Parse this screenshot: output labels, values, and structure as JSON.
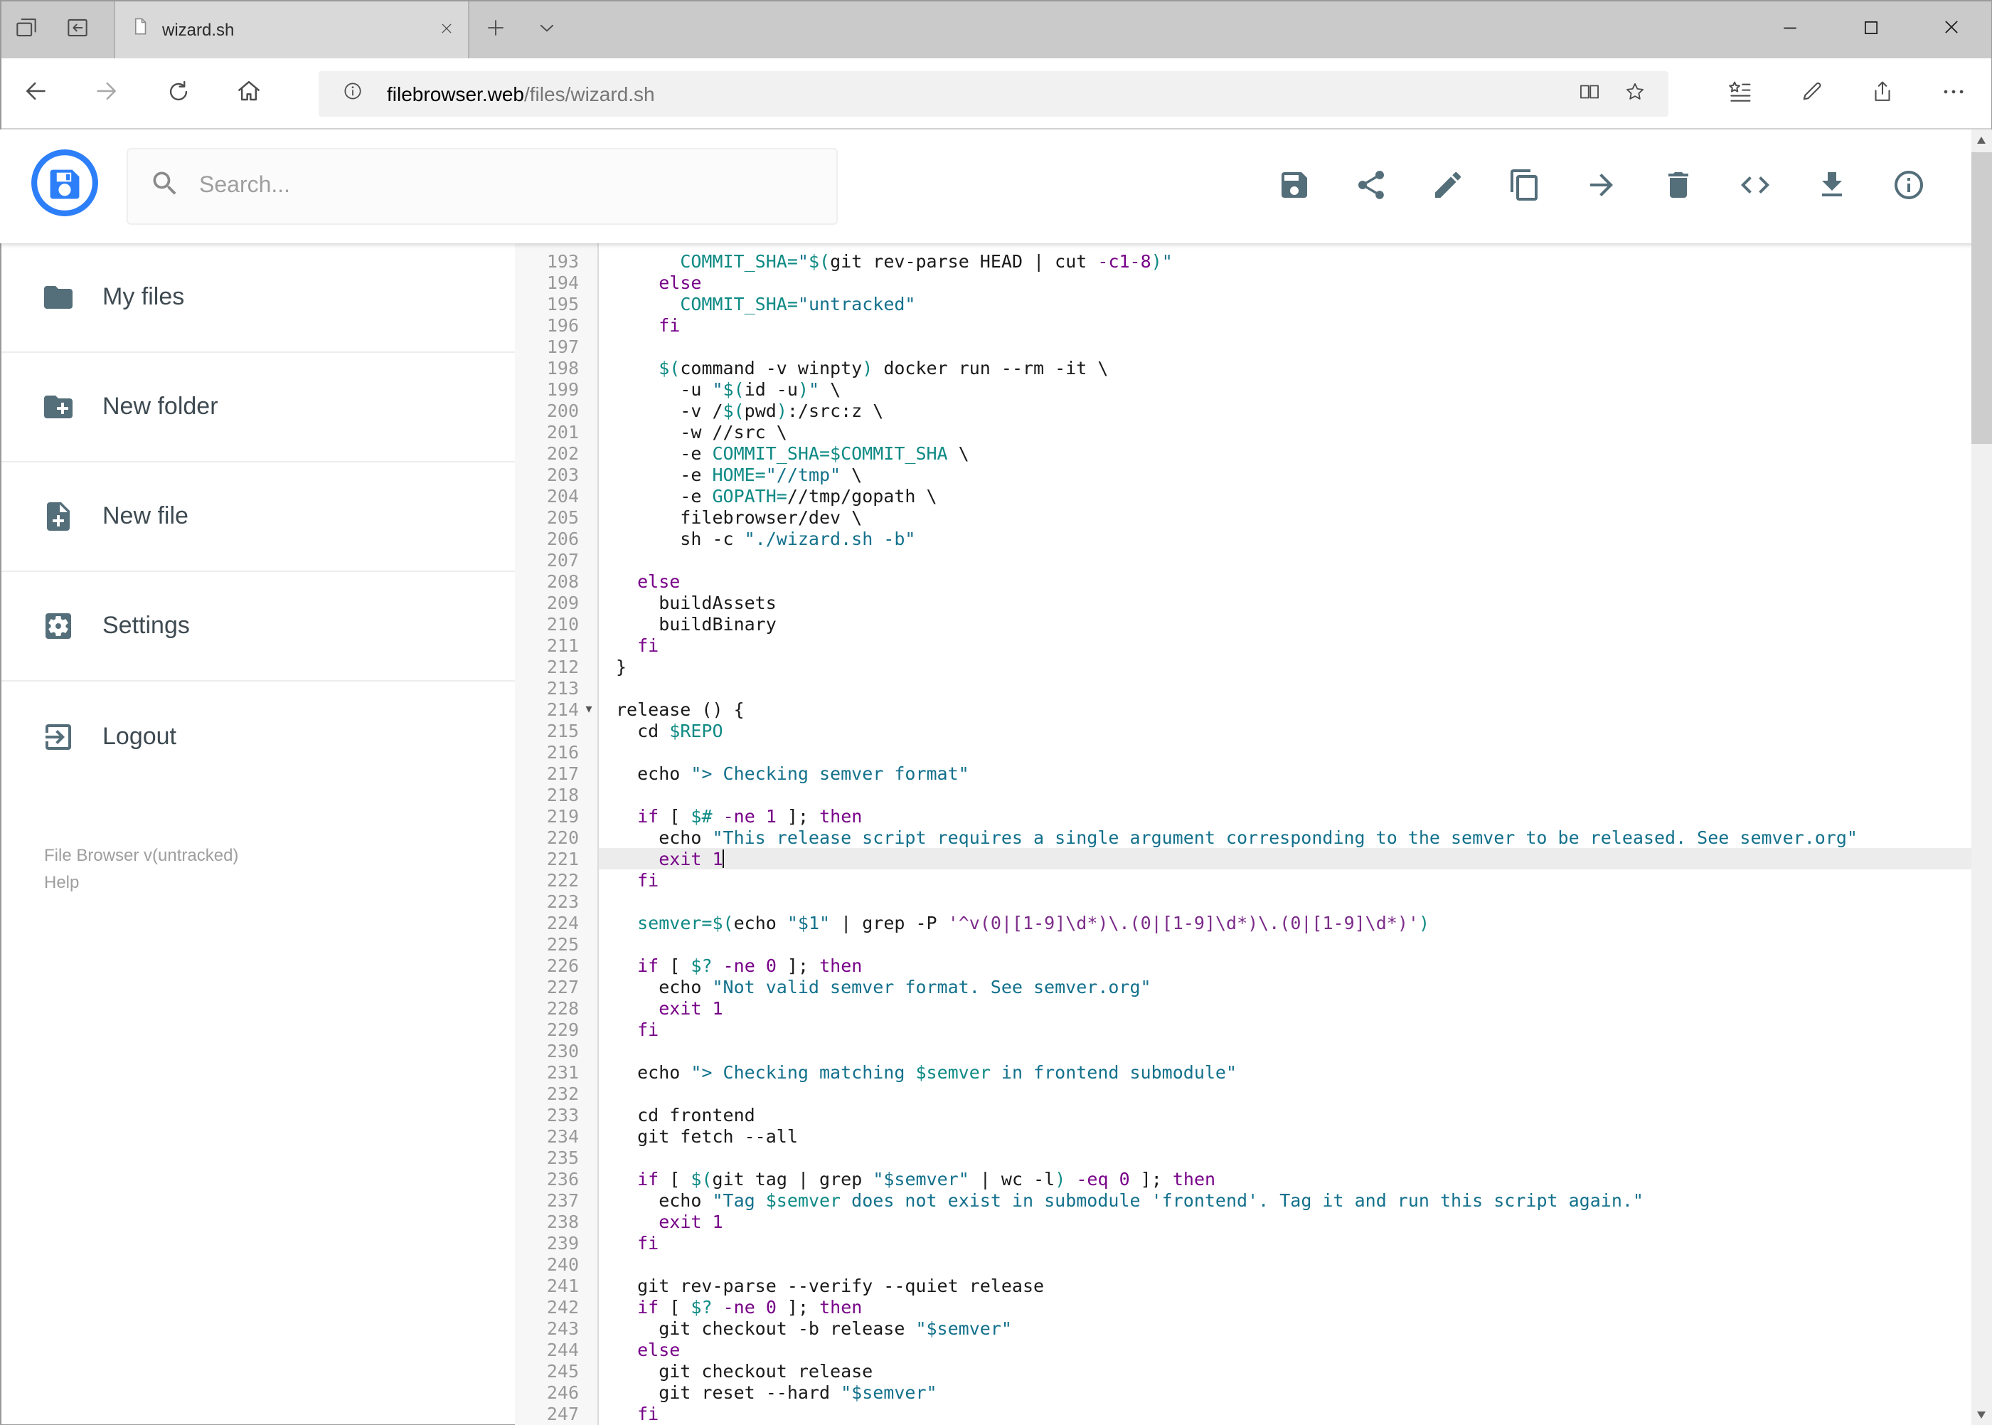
{
  "browser": {
    "tab_title": "wizard.sh",
    "url_host": "filebrowser.web",
    "url_path": "/files/wizard.sh"
  },
  "header": {
    "search_placeholder": "Search..."
  },
  "sidebar": {
    "items": [
      {
        "label": "My files"
      },
      {
        "label": "New folder"
      },
      {
        "label": "New file"
      },
      {
        "label": "Settings"
      },
      {
        "label": "Logout"
      }
    ],
    "version": "File Browser v(untracked)",
    "help": "Help"
  },
  "colors": {
    "accent": "#2d7ff9",
    "toolbar_icons": "#546e7a",
    "kw": "#770088",
    "vr": "#0e8a84",
    "str": "#13718c",
    "str2": "#7c2b8a",
    "num": "#770088",
    "linenum": "#999999",
    "activeline": "#ececec"
  },
  "editor": {
    "active_line": 221,
    "cursor_line": 221,
    "fold_line": 214,
    "fold_glyph": "▾",
    "lines": [
      {
        "n": 193,
        "t": [
          [
            "p",
            "      "
          ],
          [
            "v",
            "COMMIT_SHA="
          ],
          [
            "s",
            "\""
          ],
          [
            "v",
            "$("
          ],
          [
            "p",
            "git rev-parse HEAD | cut "
          ],
          [
            "n",
            "-c1-8"
          ],
          [
            "v",
            ")"
          ],
          [
            "s",
            "\""
          ]
        ]
      },
      {
        "n": 194,
        "t": [
          [
            "p",
            "    "
          ],
          [
            "k",
            "else"
          ]
        ]
      },
      {
        "n": 195,
        "t": [
          [
            "p",
            "      "
          ],
          [
            "v",
            "COMMIT_SHA="
          ],
          [
            "s",
            "\"untracked\""
          ]
        ]
      },
      {
        "n": 196,
        "t": [
          [
            "p",
            "    "
          ],
          [
            "k",
            "fi"
          ]
        ]
      },
      {
        "n": 197,
        "t": []
      },
      {
        "n": 198,
        "t": [
          [
            "p",
            "    "
          ],
          [
            "v",
            "$("
          ],
          [
            "p",
            "command -v winpty"
          ],
          [
            "v",
            ")"
          ],
          [
            "p",
            " docker run --rm -it \\"
          ]
        ]
      },
      {
        "n": 199,
        "t": [
          [
            "p",
            "      -u "
          ],
          [
            "s",
            "\""
          ],
          [
            "v",
            "$("
          ],
          [
            "p",
            "id -u"
          ],
          [
            "v",
            ")"
          ],
          [
            "s",
            "\""
          ],
          [
            "p",
            " \\"
          ]
        ]
      },
      {
        "n": 200,
        "t": [
          [
            "p",
            "      -v /"
          ],
          [
            "v",
            "$("
          ],
          [
            "p",
            "pwd"
          ],
          [
            "v",
            ")"
          ],
          [
            "p",
            ":/src:z \\"
          ]
        ]
      },
      {
        "n": 201,
        "t": [
          [
            "p",
            "      -w //src \\"
          ]
        ]
      },
      {
        "n": 202,
        "t": [
          [
            "p",
            "      -e "
          ],
          [
            "v",
            "COMMIT_SHA=$COMMIT_SHA"
          ],
          [
            "p",
            " \\"
          ]
        ]
      },
      {
        "n": 203,
        "t": [
          [
            "p",
            "      -e "
          ],
          [
            "v",
            "HOME="
          ],
          [
            "s",
            "\"//tmp\""
          ],
          [
            "p",
            " \\"
          ]
        ]
      },
      {
        "n": 204,
        "t": [
          [
            "p",
            "      -e "
          ],
          [
            "v",
            "GOPATH="
          ],
          [
            "p",
            "//tmp/gopath \\"
          ]
        ]
      },
      {
        "n": 205,
        "t": [
          [
            "p",
            "      filebrowser/dev \\"
          ]
        ]
      },
      {
        "n": 206,
        "t": [
          [
            "p",
            "      sh -c "
          ],
          [
            "s",
            "\"./wizard.sh -b\""
          ]
        ]
      },
      {
        "n": 207,
        "t": []
      },
      {
        "n": 208,
        "t": [
          [
            "p",
            "  "
          ],
          [
            "k",
            "else"
          ]
        ]
      },
      {
        "n": 209,
        "t": [
          [
            "p",
            "    buildAssets"
          ]
        ]
      },
      {
        "n": 210,
        "t": [
          [
            "p",
            "    buildBinary"
          ]
        ]
      },
      {
        "n": 211,
        "t": [
          [
            "p",
            "  "
          ],
          [
            "k",
            "fi"
          ]
        ]
      },
      {
        "n": 212,
        "t": [
          [
            "p",
            "}"
          ]
        ]
      },
      {
        "n": 213,
        "t": []
      },
      {
        "n": 214,
        "t": [
          [
            "p",
            "release () {"
          ]
        ]
      },
      {
        "n": 215,
        "t": [
          [
            "p",
            "  cd "
          ],
          [
            "v",
            "$REPO"
          ]
        ]
      },
      {
        "n": 216,
        "t": []
      },
      {
        "n": 217,
        "t": [
          [
            "p",
            "  echo "
          ],
          [
            "s",
            "\"> Checking semver format\""
          ]
        ]
      },
      {
        "n": 218,
        "t": []
      },
      {
        "n": 219,
        "t": [
          [
            "p",
            "  "
          ],
          [
            "k",
            "if"
          ],
          [
            "p",
            " [ "
          ],
          [
            "v",
            "$#"
          ],
          [
            "p",
            " "
          ],
          [
            "n",
            "-ne"
          ],
          [
            "p",
            " "
          ],
          [
            "n",
            "1"
          ],
          [
            "p",
            " ]; "
          ],
          [
            "k",
            "then"
          ]
        ]
      },
      {
        "n": 220,
        "t": [
          [
            "p",
            "    echo "
          ],
          [
            "s",
            "\"This release script requires a single argument corresponding to the semver to be released. See semver.org\""
          ]
        ]
      },
      {
        "n": 221,
        "t": [
          [
            "p",
            "    "
          ],
          [
            "k",
            "exit"
          ],
          [
            "p",
            " "
          ],
          [
            "n",
            "1"
          ]
        ]
      },
      {
        "n": 222,
        "t": [
          [
            "p",
            "  "
          ],
          [
            "k",
            "fi"
          ]
        ]
      },
      {
        "n": 223,
        "t": []
      },
      {
        "n": 224,
        "t": [
          [
            "p",
            "  "
          ],
          [
            "v",
            "semver=$("
          ],
          [
            "p",
            "echo "
          ],
          [
            "s",
            "\"$1\""
          ],
          [
            "p",
            " | grep -P "
          ],
          [
            "s2",
            "'^v(0|[1-9]\\d*)\\.(0|[1-9]\\d*)\\.(0|[1-9]\\d*)'"
          ],
          [
            "v",
            ")"
          ]
        ]
      },
      {
        "n": 225,
        "t": []
      },
      {
        "n": 226,
        "t": [
          [
            "p",
            "  "
          ],
          [
            "k",
            "if"
          ],
          [
            "p",
            " [ "
          ],
          [
            "v",
            "$?"
          ],
          [
            "p",
            " "
          ],
          [
            "n",
            "-ne"
          ],
          [
            "p",
            " "
          ],
          [
            "n",
            "0"
          ],
          [
            "p",
            " ]; "
          ],
          [
            "k",
            "then"
          ]
        ]
      },
      {
        "n": 227,
        "t": [
          [
            "p",
            "    echo "
          ],
          [
            "s",
            "\"Not valid semver format. See semver.org\""
          ]
        ]
      },
      {
        "n": 228,
        "t": [
          [
            "p",
            "    "
          ],
          [
            "k",
            "exit"
          ],
          [
            "p",
            " "
          ],
          [
            "n",
            "1"
          ]
        ]
      },
      {
        "n": 229,
        "t": [
          [
            "p",
            "  "
          ],
          [
            "k",
            "fi"
          ]
        ]
      },
      {
        "n": 230,
        "t": []
      },
      {
        "n": 231,
        "t": [
          [
            "p",
            "  echo "
          ],
          [
            "s",
            "\"> Checking matching "
          ],
          [
            "v",
            "$semver"
          ],
          [
            "s",
            " in frontend submodule\""
          ]
        ]
      },
      {
        "n": 232,
        "t": []
      },
      {
        "n": 233,
        "t": [
          [
            "p",
            "  cd frontend"
          ]
        ]
      },
      {
        "n": 234,
        "t": [
          [
            "p",
            "  git fetch --all"
          ]
        ]
      },
      {
        "n": 235,
        "t": []
      },
      {
        "n": 236,
        "t": [
          [
            "p",
            "  "
          ],
          [
            "k",
            "if"
          ],
          [
            "p",
            " [ "
          ],
          [
            "v",
            "$("
          ],
          [
            "p",
            "git tag | grep "
          ],
          [
            "s",
            "\"$semver\""
          ],
          [
            "p",
            " | wc -l"
          ],
          [
            "v",
            ")"
          ],
          [
            "p",
            " "
          ],
          [
            "n",
            "-eq"
          ],
          [
            "p",
            " "
          ],
          [
            "n",
            "0"
          ],
          [
            "p",
            " ]; "
          ],
          [
            "k",
            "then"
          ]
        ]
      },
      {
        "n": 237,
        "t": [
          [
            "p",
            "    echo "
          ],
          [
            "s",
            "\"Tag "
          ],
          [
            "v",
            "$semver"
          ],
          [
            "s",
            " does not exist in submodule 'frontend'. Tag it and run this script again.\""
          ]
        ]
      },
      {
        "n": 238,
        "t": [
          [
            "p",
            "    "
          ],
          [
            "k",
            "exit"
          ],
          [
            "p",
            " "
          ],
          [
            "n",
            "1"
          ]
        ]
      },
      {
        "n": 239,
        "t": [
          [
            "p",
            "  "
          ],
          [
            "k",
            "fi"
          ]
        ]
      },
      {
        "n": 240,
        "t": []
      },
      {
        "n": 241,
        "t": [
          [
            "p",
            "  git rev-parse --verify --quiet release"
          ]
        ]
      },
      {
        "n": 242,
        "t": [
          [
            "p",
            "  "
          ],
          [
            "k",
            "if"
          ],
          [
            "p",
            " [ "
          ],
          [
            "v",
            "$?"
          ],
          [
            "p",
            " "
          ],
          [
            "n",
            "-ne"
          ],
          [
            "p",
            " "
          ],
          [
            "n",
            "0"
          ],
          [
            "p",
            " ]; "
          ],
          [
            "k",
            "then"
          ]
        ]
      },
      {
        "n": 243,
        "t": [
          [
            "p",
            "    git checkout -b release "
          ],
          [
            "s",
            "\"$semver\""
          ]
        ]
      },
      {
        "n": 244,
        "t": [
          [
            "p",
            "  "
          ],
          [
            "k",
            "else"
          ]
        ]
      },
      {
        "n": 245,
        "t": [
          [
            "p",
            "    git checkout release"
          ]
        ]
      },
      {
        "n": 246,
        "t": [
          [
            "p",
            "    git reset --hard "
          ],
          [
            "s",
            "\"$semver\""
          ]
        ]
      },
      {
        "n": 247,
        "t": [
          [
            "p",
            "  "
          ],
          [
            "k",
            "fi"
          ]
        ]
      }
    ]
  }
}
